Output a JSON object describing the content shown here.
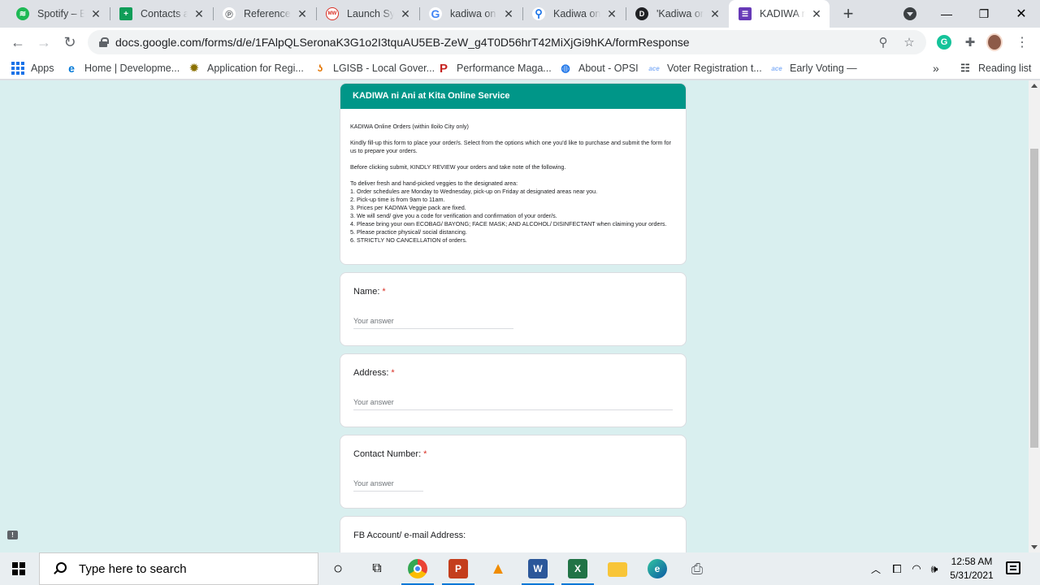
{
  "browser": {
    "tabs": [
      {
        "title": "Spotify – Eu",
        "icon": "spotify-icon",
        "color": "#1db954"
      },
      {
        "title": "Contacts an",
        "icon": "contacts-sheet-icon",
        "color": "#0f9d58"
      },
      {
        "title": "Reference L",
        "icon": "reference-icon",
        "color": "#5f6368"
      },
      {
        "title": "Launch Sync",
        "icon": "merriam-webster-icon",
        "color": "#d93025"
      },
      {
        "title": "kadiwa on v",
        "icon": "google-icon",
        "color": "#4285f4"
      },
      {
        "title": "Kadiwa on V",
        "icon": "maps-pin-icon",
        "color": "#1a73e8"
      },
      {
        "title": "'Kadiwa on",
        "icon": "d-logo-icon",
        "color": "#202124"
      },
      {
        "title": "KADIWA ni",
        "icon": "google-forms-icon",
        "color": "#673ab7",
        "active": true
      }
    ],
    "new_tab": "+",
    "window_controls": {
      "minimize": "—",
      "restore": "❐",
      "close": "✕"
    },
    "url": "docs.google.com/forms/d/e/1FAlpQLSeronaK3G1o2I3tquAU5EB-ZeW_g4T0D56hrT42MiXjGi9hKA/formResponse",
    "bookmarks": [
      {
        "label": "Apps",
        "icon": "apps-grid-icon"
      },
      {
        "label": "Home | Developme...",
        "icon": "edge-icon"
      },
      {
        "label": "Application for Regi...",
        "icon": "seal-icon"
      },
      {
        "label": "LGISB - Local Gover...",
        "icon": "lgisb-icon"
      },
      {
        "label": "Performance Maga...",
        "icon": "performance-p-icon"
      },
      {
        "label": "About - OPSI",
        "icon": "globe-icon"
      },
      {
        "label": "Voter Registration t...",
        "icon": "ace-icon"
      },
      {
        "label": "Early Voting —",
        "icon": "ace-icon"
      }
    ],
    "reading_list": "Reading list"
  },
  "form": {
    "header_title": "KADIWA ni Ani at Kita Online Service",
    "description": [
      "KADIWA Online Orders (within Iloilo City only)",
      "",
      "Kindly fill-up this form to place your order/s.  Select from the options which one you'd like to purchase and submit the form for us to prepare your orders.",
      "",
      "Before clicking submit, KINDLY REVIEW your orders and take note of the following.",
      "",
      "To deliver fresh and hand-picked veggies to the designated area:",
      "1. Order schedules are Monday to Wednesday, pick-up on Friday at designated areas near you.",
      "2. Pick-up time is from 9am to 11am.",
      "3.  Prices per KADIWA Veggie pack are fixed.",
      "3. We will send/ give you a code for verification and confirmation of your order/s.",
      "4.  Please bring your own ECOBAG/ BAYONG; FACE MASK; AND ALCOHOL/ DISINFECTANT when claiming your orders.",
      "5.  Please practice physical/ social distancing.",
      "6.  STRICTLY NO CANCELLATION of orders."
    ],
    "questions": [
      {
        "label": "Name:",
        "required": "*",
        "placeholder": "Your answer"
      },
      {
        "label": "Address:",
        "required": "*",
        "placeholder": "Your answer"
      },
      {
        "label": "Contact Number:",
        "required": "*",
        "placeholder": "Your answer"
      },
      {
        "label": "FB Account/ e-mail Address:",
        "required": "",
        "placeholder": ""
      }
    ],
    "accent_color": "#009688",
    "background_color": "#d9efef"
  },
  "taskbar": {
    "search_placeholder": "Type here to search",
    "apps": [
      "cortana-icon",
      "task-view-icon",
      "chrome-icon",
      "powerpoint-icon",
      "vlc-icon",
      "word-icon",
      "excel-icon",
      "file-explorer-icon",
      "edge-icon",
      "printer-icon"
    ],
    "time": "12:58 AM",
    "date": "5/31/2021"
  }
}
